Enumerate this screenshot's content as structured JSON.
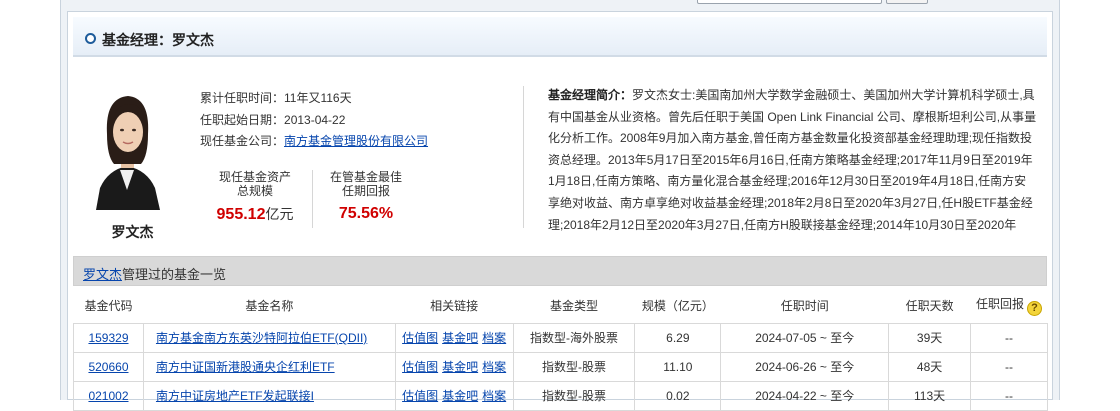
{
  "header": {
    "title": "基金经理：罗文杰"
  },
  "manager": {
    "name": "罗文杰",
    "tenure_label": "累计任职时间：",
    "tenure_value": "11年又116天",
    "start_label": "任职起始日期：",
    "start_value": "2013-04-22",
    "company_label": "现任基金公司：",
    "company_value": "南方基金管理股份有限公司"
  },
  "stats": {
    "assets_label_1": "现任基金资产",
    "assets_label_2": "总规模",
    "assets_value": "955.12",
    "assets_unit": "亿元",
    "return_label_1": "在管基金最佳",
    "return_label_2": "任期回报",
    "return_value": "75.56%"
  },
  "bio": {
    "label": "基金经理简介：",
    "text": "罗文杰女士:美国南加州大学数学金融硕士、美国加州大学计算机科学硕士,具有中国基金从业资格。曾先后任职于美国 Open Link Financial 公司、摩根斯坦利公司,从事量化分析工作。2008年9月加入南方基金,曾任南方基金数量化投资部基金经理助理;现任指数投资总经理。2013年5月17日至2015年6月16日,任南方策略基金经理;2017年11月9日至2019年1月18日,任南方策略、南方量化混合基金经理;2016年12月30日至2019年4月18日,任南方安享绝对收益、南方卓享绝对收益基金经理;2018年2月8日至2020年3月27日,任H股ETF基金经理;2018年2月12日至2020年3月27日,任南方H股联接基金经理;2014年10月30日至2020年"
  },
  "list": {
    "title_link": "罗文杰",
    "title_rest": "管理过的基金一览",
    "columns": [
      "基金代码",
      "基金名称",
      "相关链接",
      "基金类型",
      "规模（亿元）",
      "任职时间",
      "任职天数",
      "任职回报"
    ],
    "help_icon": "question-icon",
    "link_labels": [
      "估值图",
      "基金吧",
      "档案"
    ],
    "rows": [
      {
        "code": "159329",
        "name": "南方基金南方东英沙特阿拉伯ETF(QDII)",
        "type": "指数型-海外股票",
        "size": "6.29",
        "period": "2024-07-05 ~ 至今",
        "days": "39天",
        "ret": "--"
      },
      {
        "code": "520660",
        "name": "南方中证国新港股通央企红利ETF",
        "type": "指数型-股票",
        "size": "11.10",
        "period": "2024-06-26 ~ 至今",
        "days": "48天",
        "ret": "--"
      },
      {
        "code": "021002",
        "name": "南方中证房地产ETF发起联接I",
        "type": "指数型-股票",
        "size": "0.02",
        "period": "2024-04-22 ~ 至今",
        "days": "113天",
        "ret": "--"
      }
    ]
  },
  "colors": {
    "link": "#0645ad",
    "highlight": "#d00000",
    "header_ring": "#1e5c9b"
  }
}
